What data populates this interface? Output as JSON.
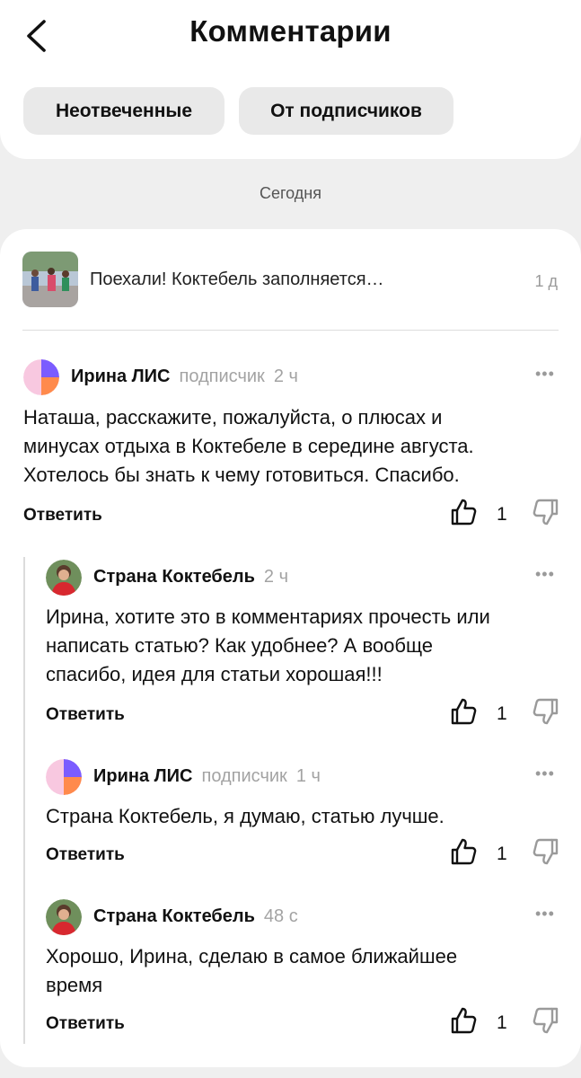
{
  "header": {
    "title": "Комментарии",
    "filters": [
      "Неотвеченные",
      "От подписчиков"
    ]
  },
  "date_separator": "Сегодня",
  "post": {
    "text": "Поехали! Коктебель заполняется…",
    "age": "1 д"
  },
  "comments": [
    {
      "author": "Ирина ЛИС",
      "badge": "подписчик",
      "time": "2 ч",
      "lines": [
        "Наташа, расскажите, пожалуйста, о плюсах и",
        "минусах отдыха в Коктебеле в середине августа.",
        "Хотелось бы знать к чему готовиться. Спасибо."
      ],
      "reply_label": "Ответить",
      "likes": "1"
    },
    {
      "author": "Страна Коктебель",
      "time": "2 ч",
      "lines": [
        "Ирина, хотите это в комментариях прочесть или",
        "написать статью? Как удобнее? А вообще",
        "спасибо, идея для статьи хорошая!!!"
      ],
      "reply_label": "Ответить",
      "likes": "1"
    },
    {
      "author": "Ирина ЛИС",
      "badge": "подписчик",
      "time": "1 ч",
      "lines": [
        "Страна Коктебель, я думаю, статью лучше."
      ],
      "reply_label": "Ответить",
      "likes": "1"
    },
    {
      "author": "Страна Коктебель",
      "time": "48 с",
      "lines": [
        "Хорошо, Ирина, сделаю в самое ближайшее",
        "время"
      ],
      "reply_label": "Ответить",
      "likes": "1"
    }
  ],
  "more_glyph": "•••",
  "colors": {
    "background": "#efefef",
    "card": "#ffffff",
    "chip": "#e9e9e9",
    "muted": "#a3a3a3"
  },
  "icons": [
    "chevron-left-icon",
    "more-icon",
    "thumbs-up-icon",
    "thumbs-down-icon"
  ]
}
